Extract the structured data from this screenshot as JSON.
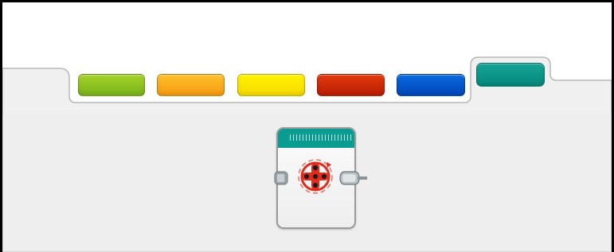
{
  "palette": {
    "colors": {
      "canvas": "#ffffff",
      "panel": "#f0f0f0",
      "panel_border": "#b8b8b8"
    },
    "tabs": [
      {
        "id": "action",
        "color_top": "#a6d22a",
        "color_bottom": "#78b31a",
        "active": false
      },
      {
        "id": "flow",
        "color_top": "#ffc02a",
        "color_bottom": "#f59a12",
        "active": false
      },
      {
        "id": "sensor",
        "color_top": "#fff200",
        "color_bottom": "#f6d900",
        "active": false
      },
      {
        "id": "data",
        "color_top": "#e23a0c",
        "color_bottom": "#b91d05",
        "active": false
      },
      {
        "id": "advanced",
        "color_top": "#0a6ae0",
        "color_bottom": "#0146b8",
        "active": false
      },
      {
        "id": "my-blocks",
        "color_top": "#14a395",
        "color_bottom": "#068a7d",
        "active": true
      }
    ]
  },
  "block": {
    "icon": "move-crosshair-icon",
    "cap_color": "#0a9c90",
    "icon_color": "#e22b1a"
  }
}
